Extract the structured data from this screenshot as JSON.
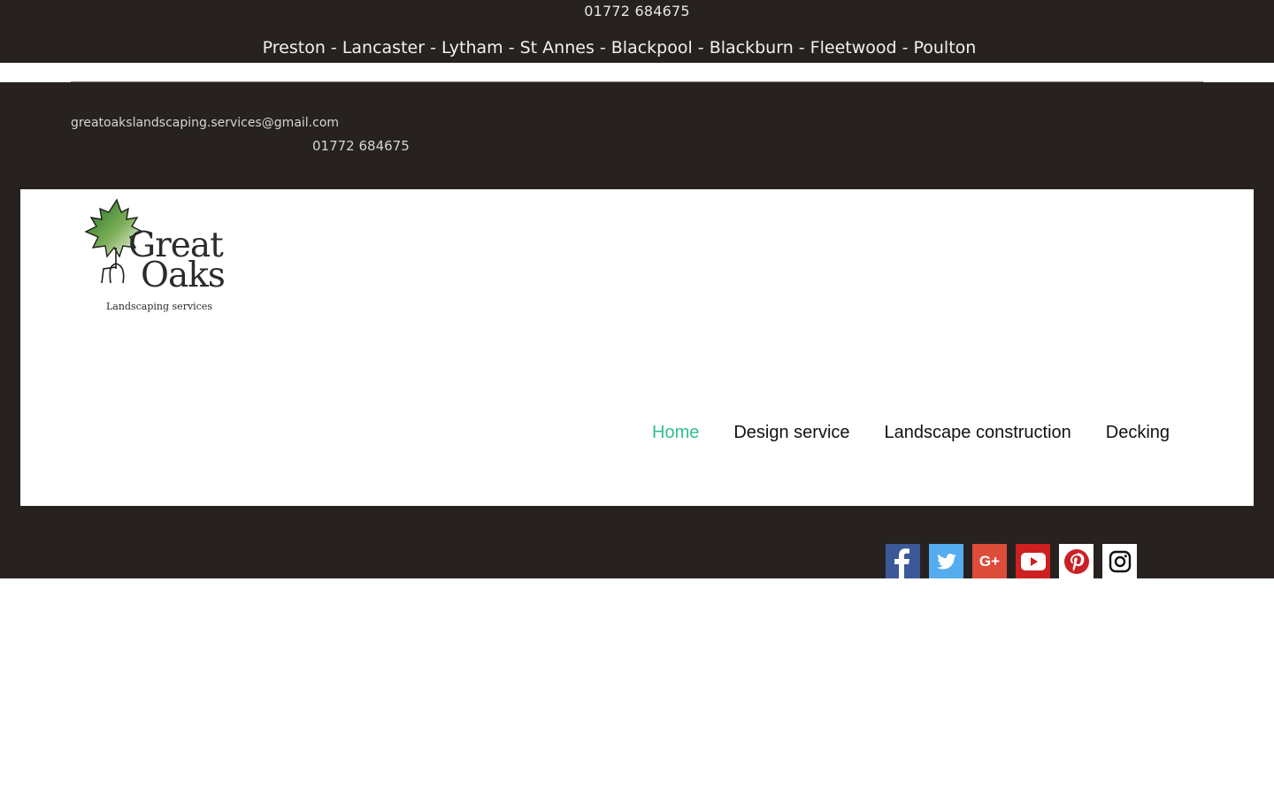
{
  "topbar": {
    "phone": "01772 684675",
    "locations": "Preston - Lancaster - Lytham - St Annes - Blackpool - Blackburn - Fleetwood - Poulton"
  },
  "contact": {
    "email": "greatoakslandscaping.services@gmail.com",
    "phone": "01772 684675"
  },
  "logo": {
    "word1": "Great",
    "word2": "Oaks",
    "tagline": "Landscaping services"
  },
  "nav": {
    "items": [
      {
        "label": "Home",
        "active": true
      },
      {
        "label": "Design service",
        "active": false
      },
      {
        "label": "Landscape construction",
        "active": false
      },
      {
        "label": "Decking",
        "active": false
      }
    ],
    "active_color": "#2fbf94"
  },
  "social": {
    "icons": [
      "facebook-icon",
      "twitter-icon",
      "google-plus-icon",
      "youtube-icon",
      "pinterest-icon",
      "instagram-icon"
    ],
    "colors": {
      "facebook": "#3b5998",
      "twitter": "#55acee",
      "google_plus": "#dd4b39",
      "youtube": "#cd201f",
      "pinterest": "#ffffff",
      "instagram": "#ffffff"
    },
    "google_plus_text": "G+"
  },
  "theme": {
    "dark": "#272220",
    "white": "#ffffff"
  }
}
